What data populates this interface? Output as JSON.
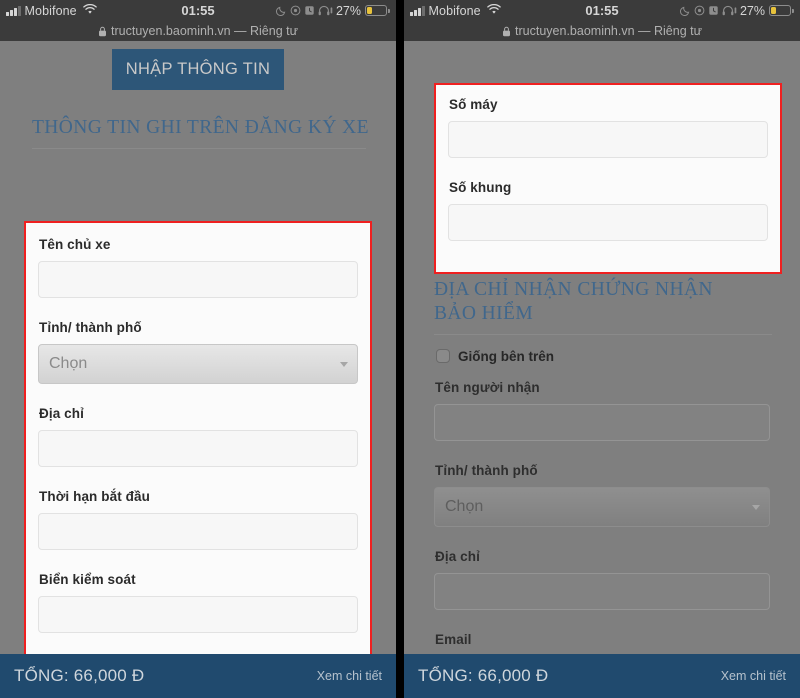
{
  "status_bar": {
    "carrier": "Mobifone",
    "wifi_icon": "wifi-icon",
    "time": "01:55",
    "moon_icon": "moon-icon",
    "location_icon": "location-icon",
    "alarm_icon": "alarm-icon",
    "headphones_icon": "headphones-icon",
    "battery_percent": "27%",
    "battery_level": 27
  },
  "browser": {
    "lock_icon": "lock-icon",
    "url": "tructuyen.baominh.vn — Riêng tư"
  },
  "colors": {
    "accent_blue": "#2d5678",
    "bottom_bar": "#204a6e",
    "heading_blue": "#40678c",
    "highlight_red": "#ef2020",
    "page_background": "#7f7f7f"
  },
  "left_screen": {
    "tab_label": "NHẬP THÔNG TIN",
    "section_title": "THÔNG TIN GHI TRÊN ĐĂNG KÝ XE",
    "fields": [
      {
        "label": "Tên chủ xe",
        "type": "text",
        "value": ""
      },
      {
        "label": "Tỉnh/ thành phố",
        "type": "select",
        "value": "Chọn"
      },
      {
        "label": "Địa chỉ",
        "type": "text",
        "value": ""
      },
      {
        "label": "Thời hạn bắt đầu",
        "type": "text",
        "value": ""
      },
      {
        "label": "Biển kiểm soát",
        "type": "text",
        "value": ""
      }
    ]
  },
  "right_screen": {
    "highlighted_fields": [
      {
        "label": "Số máy",
        "type": "text",
        "value": ""
      },
      {
        "label": "Số khung",
        "type": "text",
        "value": ""
      }
    ],
    "section_title": "ĐỊA CHỈ NHẬN CHỨNG NHẬN BẢO HIỂM",
    "checkbox_label": "Giống bên trên",
    "checkbox_checked": false,
    "fields": [
      {
        "label": "Tên người nhận",
        "type": "text",
        "value": ""
      },
      {
        "label": "Tỉnh/ thành phố",
        "type": "select",
        "value": "Chọn"
      },
      {
        "label": "Địa chỉ",
        "type": "text",
        "value": ""
      },
      {
        "label": "Email",
        "type": "text",
        "value": ""
      }
    ]
  },
  "bottom_bar": {
    "total_label": "TỔNG: 66,000 Đ",
    "detail_link": "Xem chi tiết"
  }
}
